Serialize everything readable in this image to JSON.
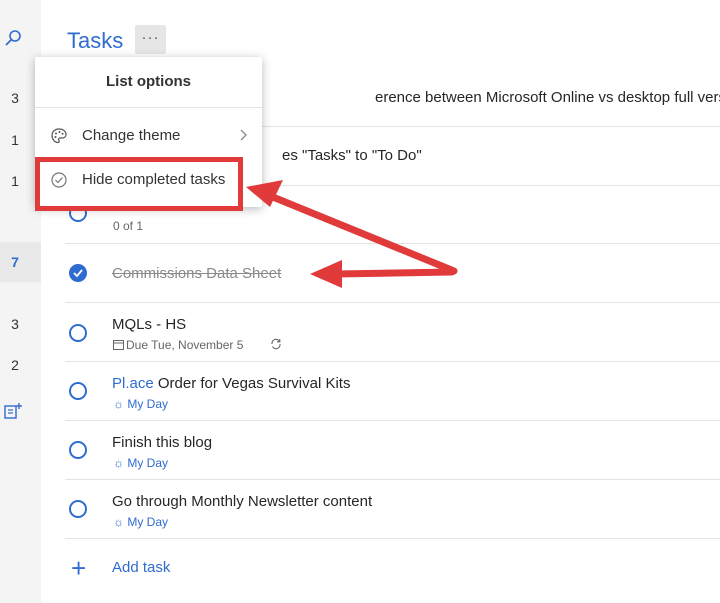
{
  "sidebar": {
    "counts": [
      {
        "value": "3",
        "active": false
      },
      {
        "value": "1",
        "active": false
      },
      {
        "value": "1",
        "active": false
      },
      {
        "value": "7",
        "active": true
      },
      {
        "value": "3",
        "active": false
      },
      {
        "value": "2",
        "active": false
      }
    ],
    "search_icon": "search-icon",
    "new_list_icon": "new-list-icon"
  },
  "header": {
    "title": "Tasks",
    "more_label": "···"
  },
  "tasks": [
    {
      "text": "erence between Microsoft Online vs desktop full version",
      "sub": "",
      "done": false
    },
    {
      "text": "es \"Tasks\" to \"To Do\"",
      "sub": "",
      "done": false
    },
    {
      "text": "",
      "sub": "0 of 1",
      "done": false
    },
    {
      "text": "Commissions Data Sheet",
      "sub": "",
      "done": true
    },
    {
      "text": "MQLs - HS",
      "sub": "Due Tue, November 5",
      "done": false
    },
    {
      "link_word": "Pl.ace",
      "text": " Order for Vegas Survival Kits",
      "sub": "My Day",
      "done": false
    },
    {
      "text": "Finish this blog",
      "sub": "My Day",
      "done": false
    },
    {
      "text": "Go through Monthly Newsletter content",
      "sub": "My Day",
      "done": false
    }
  ],
  "add_task": {
    "label": "Add task",
    "icon": "plus-icon"
  },
  "menu": {
    "title": "List options",
    "items": [
      {
        "label": "Change theme",
        "icon": "palette-icon",
        "has_submenu": true
      },
      {
        "label": "Hide completed tasks",
        "icon": "check-circle-icon",
        "has_submenu": false
      }
    ]
  },
  "colors": {
    "accent": "#2f6ccf",
    "annotation": "#e03a3a",
    "sidebar_bg": "#f4f4f4"
  }
}
